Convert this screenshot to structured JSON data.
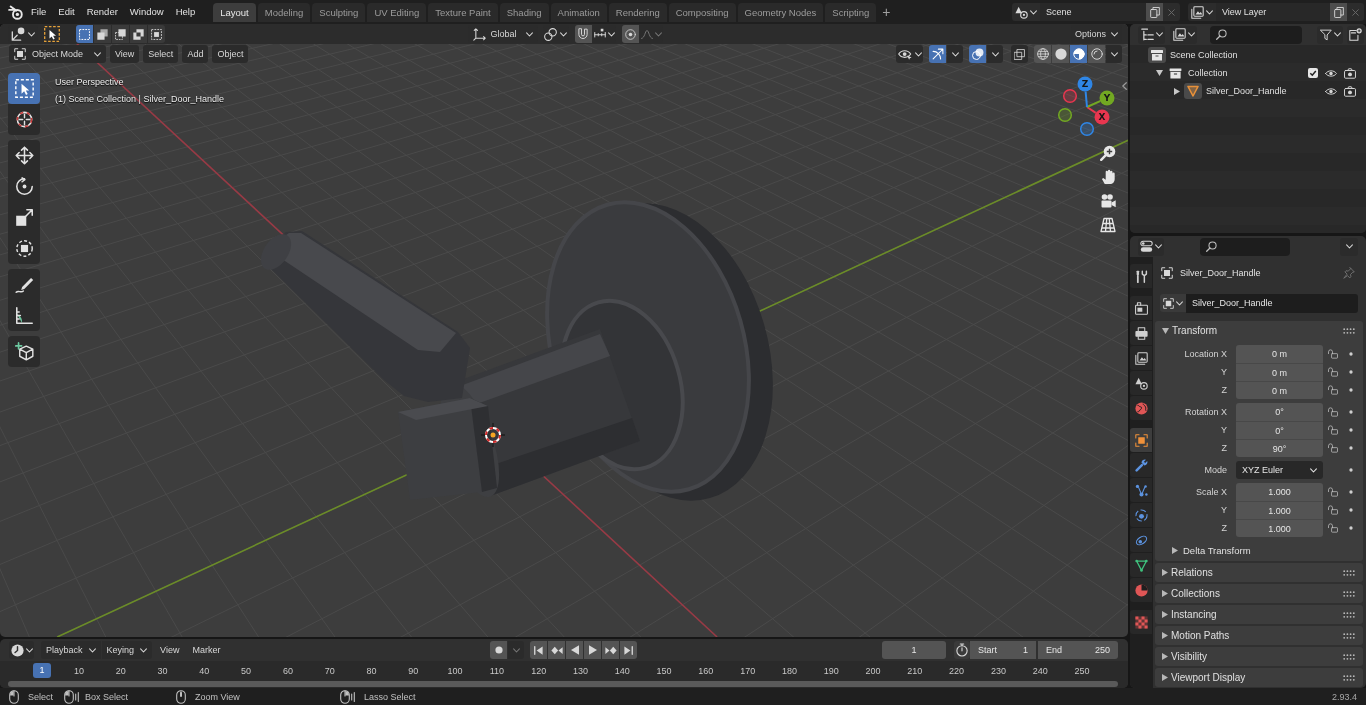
{
  "topbar": {
    "menus": [
      "File",
      "Edit",
      "Render",
      "Window",
      "Help"
    ],
    "workspaces": [
      {
        "label": "Layout",
        "selected": true
      },
      {
        "label": "Modeling",
        "selected": false
      },
      {
        "label": "Sculpting",
        "selected": false
      },
      {
        "label": "UV Editing",
        "selected": false
      },
      {
        "label": "Texture Paint",
        "selected": false
      },
      {
        "label": "Shading",
        "selected": false
      },
      {
        "label": "Animation",
        "selected": false
      },
      {
        "label": "Rendering",
        "selected": false
      },
      {
        "label": "Compositing",
        "selected": false
      },
      {
        "label": "Geometry Nodes",
        "selected": false
      },
      {
        "label": "Scripting",
        "selected": false
      }
    ],
    "add_workspace": "+",
    "scene": "Scene",
    "view_layer": "View Layer"
  },
  "viewport": {
    "select_modes": [
      {
        "kind": "set",
        "selected": true
      },
      {
        "kind": "extend",
        "selected": false
      },
      {
        "kind": "subtract",
        "selected": false
      },
      {
        "kind": "difference",
        "selected": false
      },
      {
        "kind": "intersect",
        "selected": false
      }
    ],
    "orientation": "Global",
    "snapping": false,
    "proportional_editing": false,
    "options": "Options",
    "mode": "Object Mode",
    "menus": [
      "View",
      "Select",
      "Add",
      "Object"
    ],
    "gizmos": true,
    "overlays": true,
    "xray": false,
    "shading": [
      {
        "kind": "wireframe",
        "selected": false
      },
      {
        "kind": "solid",
        "selected": false
      },
      {
        "kind": "material",
        "selected": true
      },
      {
        "kind": "rendered",
        "selected": false
      }
    ],
    "tool_groups": [
      {
        "tools": [
          {
            "kind": "select_box",
            "selected": true
          },
          {
            "kind": "cursor",
            "selected": false
          }
        ]
      },
      {
        "tools": [
          {
            "kind": "move",
            "selected": false
          },
          {
            "kind": "rotate",
            "selected": false
          },
          {
            "kind": "scale",
            "selected": false
          },
          {
            "kind": "transform",
            "selected": false
          }
        ]
      },
      {
        "tools": [
          {
            "kind": "annotate",
            "selected": false
          },
          {
            "kind": "measure",
            "selected": false
          }
        ]
      },
      {
        "tools": [
          {
            "kind": "add_cube",
            "selected": false
          }
        ]
      }
    ],
    "view_name": "User Perspective",
    "info": "(1) Scene Collection | Silver_Door_Handle",
    "axes": [
      {
        "kind": "x",
        "label": "X",
        "color": "#e8364f"
      },
      {
        "kind": "y",
        "label": "Y",
        "color": "#72a822"
      },
      {
        "kind": "z",
        "label": "Z",
        "color": "#2f86e6"
      }
    ]
  },
  "outliner": {
    "items": [
      {
        "kind": "scene_collection",
        "label": "Scene Collection",
        "children": [
          {
            "kind": "collection",
            "label": "Collection",
            "expanded": true,
            "checked": true,
            "visible": true,
            "renderable": true,
            "children": [
              {
                "kind": "mesh_object",
                "label": "Silver_Door_Handle",
                "expanded": false,
                "visible": true,
                "renderable": true
              }
            ]
          }
        ]
      }
    ]
  },
  "properties": {
    "tab_groups": [
      {
        "tabs": [
          {
            "kind": "tool",
            "selected": false
          }
        ]
      },
      {
        "tabs": [
          {
            "kind": "render",
            "selected": false
          },
          {
            "kind": "output",
            "selected": false
          },
          {
            "kind": "view_layer",
            "selected": false
          },
          {
            "kind": "scene",
            "selected": false
          },
          {
            "kind": "world",
            "selected": false
          }
        ]
      },
      {
        "tabs": [
          {
            "kind": "object",
            "selected": true
          },
          {
            "kind": "modifiers",
            "selected": false
          },
          {
            "kind": "particles",
            "selected": false
          },
          {
            "kind": "physics",
            "selected": false
          },
          {
            "kind": "constraints",
            "selected": false
          },
          {
            "kind": "data",
            "selected": false
          },
          {
            "kind": "material",
            "selected": false
          }
        ]
      },
      {
        "tabs": [
          {
            "kind": "texture",
            "selected": false
          }
        ]
      }
    ],
    "object_name": "Silver_Door_Handle",
    "datablock": "Silver_Door_Handle",
    "transform": {
      "title": "Transform",
      "expanded": true,
      "groups": [
        {
          "rows": [
            {
              "kind": "number",
              "label": "Location X",
              "value": "0 m",
              "locked": false
            },
            {
              "kind": "number",
              "label": "Y",
              "value": "0 m",
              "locked": false
            },
            {
              "kind": "number",
              "label": "Z",
              "value": "0 m",
              "locked": false
            }
          ]
        },
        {
          "rows": [
            {
              "kind": "number",
              "label": "Rotation X",
              "value": "0°",
              "locked": false
            },
            {
              "kind": "number",
              "label": "Y",
              "value": "0°",
              "locked": false
            },
            {
              "kind": "number",
              "label": "Z",
              "value": "90°",
              "locked": false
            }
          ]
        },
        {
          "rows": [
            {
              "kind": "enum",
              "label": "Mode",
              "value": "XYZ Euler"
            }
          ]
        },
        {
          "rows": [
            {
              "kind": "number",
              "label": "Scale X",
              "value": "1.000",
              "locked": false
            },
            {
              "kind": "number",
              "label": "Y",
              "value": "1.000",
              "locked": false
            },
            {
              "kind": "number",
              "label": "Z",
              "value": "1.000",
              "locked": false
            }
          ]
        }
      ],
      "subpanels": [
        {
          "title": "Delta Transform",
          "expanded": false
        }
      ]
    },
    "panels": [
      {
        "title": "Relations",
        "expanded": false
      },
      {
        "title": "Collections",
        "expanded": false
      },
      {
        "title": "Instancing",
        "expanded": false
      },
      {
        "title": "Motion Paths",
        "expanded": false
      },
      {
        "title": "Visibility",
        "expanded": false
      },
      {
        "title": "Viewport Display",
        "expanded": false
      }
    ]
  },
  "timeline": {
    "menus": [
      {
        "kind": "dropdown",
        "label": "Playback"
      },
      {
        "kind": "dropdown",
        "label": "Keying"
      },
      {
        "kind": "menu",
        "label": "View"
      },
      {
        "kind": "menu",
        "label": "Marker"
      }
    ],
    "auto_keying": false,
    "current_frame": "1",
    "start_label": "Start",
    "start": "1",
    "end_label": "End",
    "end": "250",
    "playhead": "1",
    "ruler": [
      "10",
      "20",
      "30",
      "40",
      "50",
      "60",
      "70",
      "80",
      "90",
      "100",
      "110",
      "120",
      "130",
      "140",
      "150",
      "160",
      "170",
      "180",
      "190",
      "200",
      "210",
      "220",
      "230",
      "240",
      "250"
    ]
  },
  "status_bar": {
    "hints": [
      {
        "kind": "left_click",
        "label": "Select"
      },
      {
        "kind": "left_drag",
        "label": "Box Select"
      },
      {
        "kind": "middle_drag",
        "label": "Zoom View"
      },
      {
        "kind": "right_drag",
        "label": "Lasso Select"
      }
    ],
    "version": "2.93.4"
  }
}
